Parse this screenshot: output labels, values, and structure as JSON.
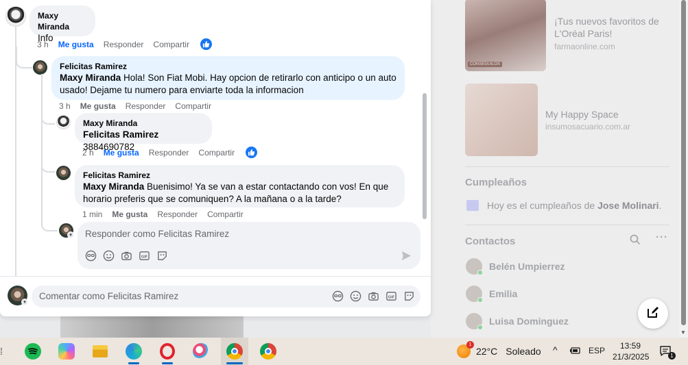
{
  "comments": [
    {
      "author": "Maxy Miranda",
      "text": "Info",
      "time": "3 h",
      "like_label": "Me gusta",
      "reply_label": "Responder",
      "share_label": "Compartir",
      "liked": true
    },
    {
      "author": "Felicitas Ramirez",
      "mention": "Maxy Miranda",
      "text": "Hola! Son Fiat Mobi. Hay opcion de retirarlo con anticipo o un auto usado! Dejame tu numero para enviarte toda la informacion",
      "time": "3 h",
      "like_label": "Me gusta",
      "reply_label": "Responder",
      "share_label": "Compartir"
    },
    {
      "author": "Maxy Miranda",
      "mention": "Felicitas Ramirez",
      "text": "3884690782",
      "time": "2 h",
      "like_label": "Me gusta",
      "reply_label": "Responder",
      "share_label": "Compartir",
      "liked": true
    },
    {
      "author": "Felicitas Ramirez",
      "mention": "Maxy Miranda",
      "text": "Buenisimo! Ya se van a estar contactando con vos! En que horario preferis que se comuniquen? A la mañana o a la tarde?",
      "time": "1 min",
      "like_label": "Me gusta",
      "reply_label": "Responder",
      "share_label": "Compartir"
    }
  ],
  "reply_box": {
    "placeholder": "Responder como Felicitas Ramirez"
  },
  "comment_box": {
    "placeholder": "Comentar como Felicitas Ramirez"
  },
  "sidebar": {
    "ads": [
      {
        "title": "¡Tus nuevos favoritos de L'Oréal Paris!",
        "domain": "farmaonline.com",
        "badge": "CONSEGUILOS"
      },
      {
        "title": "My Happy Space",
        "domain": "insumosacuario.com.ar"
      }
    ],
    "birthdays_title": "Cumpleaños",
    "birthday_text_prefix": "Hoy es el cumpleaños de ",
    "birthday_name": "Jose Molinari",
    "birthday_text_suffix": ".",
    "contacts_title": "Contactos",
    "contacts": [
      "Belén Umpierrez",
      "Emilia",
      "Luisa Dominguez"
    ]
  },
  "taskbar": {
    "weather_temp": "22°C",
    "weather_text": "Soleado",
    "weather_badge": "1",
    "language": "ESP",
    "time": "13:59",
    "date": "21/3/2025",
    "notification_count": "1"
  },
  "colors": {
    "accent": "#0866ff",
    "like_blue": "#1877f2",
    "bubble": "#f0f2f5",
    "reply_highlight": "#e7f3ff"
  }
}
